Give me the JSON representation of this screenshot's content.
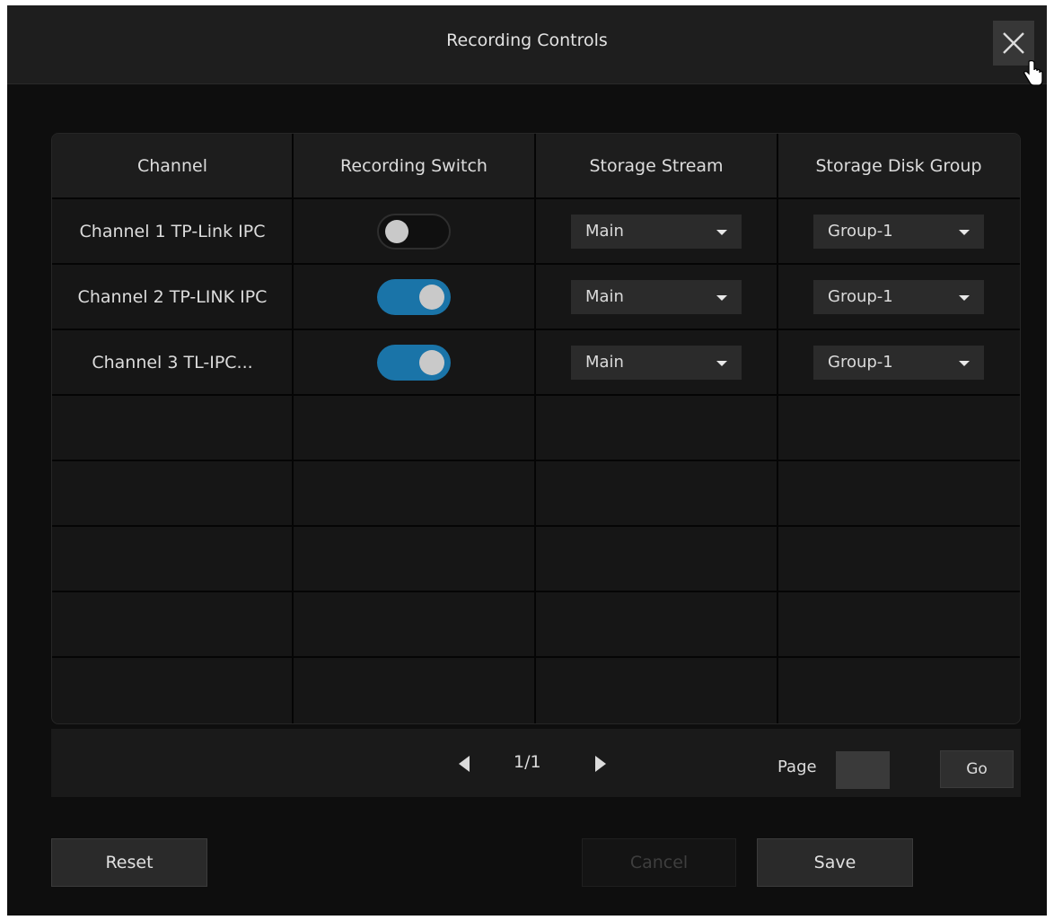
{
  "dialog": {
    "title": "Recording Controls",
    "close_icon": "close-icon"
  },
  "table": {
    "columns": [
      "Channel",
      "Recording Switch",
      "Storage Stream",
      "Storage Disk Group"
    ],
    "rows": [
      {
        "channel": "Channel 1 TP-Link IPC",
        "recording_on": false,
        "stream": "Main",
        "disk_group": "Group-1"
      },
      {
        "channel": "Channel 2 TP-LINK IPC",
        "recording_on": true,
        "stream": "Main",
        "disk_group": "Group-1"
      },
      {
        "channel": "Channel 3 TL-IPC...",
        "recording_on": true,
        "stream": "Main",
        "disk_group": "Group-1"
      }
    ]
  },
  "pagination": {
    "current": "1/1",
    "page_label": "Page",
    "page_input_value": "",
    "go_label": "Go"
  },
  "buttons": {
    "reset": "Reset",
    "cancel": "Cancel",
    "save": "Save"
  },
  "colors": {
    "toggle_on": "#1a74a8",
    "background": "#0e0e0e"
  }
}
